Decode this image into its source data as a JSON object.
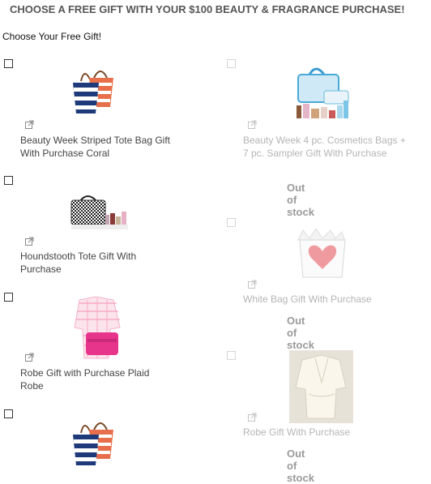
{
  "header": {
    "title": "CHOOSE A FREE GIFT WITH YOUR $100 BEAUTY & FRAGRANCE PURCHASE!"
  },
  "subtitle": "Choose Your Free Gift!",
  "gifts": [
    {
      "name": "Beauty Week Striped Tote Bag Gift With Purchase Coral",
      "available": true,
      "image": "striped-tote-image"
    },
    {
      "name": "Beauty Week 4 pc. Cosmetics Bags + 7 pc. Sampler Gift With Purchase",
      "available": false,
      "status": "Out of stock",
      "image": "cosmetics-bags-image"
    },
    {
      "name": "Houndstooth Tote Gift With Purchase",
      "available": true,
      "image": "houndstooth-tote-image"
    },
    {
      "name": "White Bag Gift With Purchase",
      "available": false,
      "status": "Out of stock",
      "image": "white-heart-bag-image"
    },
    {
      "name": "Robe Gift with Purchase Plaid Robe",
      "available": true,
      "image": "plaid-robe-image"
    },
    {
      "name": "Robe Gift With Purchase",
      "available": false,
      "status": "Out of stock",
      "image": "white-robe-image"
    },
    {
      "name": "",
      "available": true,
      "image": "striped-tote-image"
    }
  ]
}
